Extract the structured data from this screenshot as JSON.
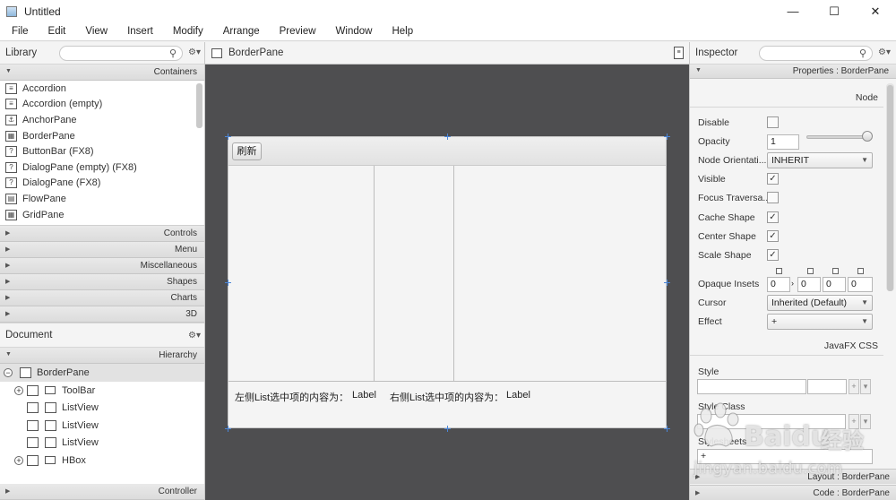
{
  "window": {
    "title": "Untitled",
    "minimize": "—",
    "maximize": "☐",
    "close": "✕"
  },
  "menu": [
    "File",
    "Edit",
    "View",
    "Insert",
    "Modify",
    "Arrange",
    "Preview",
    "Window",
    "Help"
  ],
  "library": {
    "title": "Library",
    "gear": "⚙▾",
    "containers_label": "Containers",
    "items": [
      {
        "label": "Accordion",
        "icon": "≡"
      },
      {
        "label": "Accordion  (empty)",
        "icon": "≡"
      },
      {
        "label": "AnchorPane",
        "icon": "⚓"
      },
      {
        "label": "BorderPane",
        "icon": "▦"
      },
      {
        "label": "ButtonBar  (FX8)",
        "icon": "?"
      },
      {
        "label": "DialogPane (empty)  (FX8)",
        "icon": "?"
      },
      {
        "label": "DialogPane  (FX8)",
        "icon": "?"
      },
      {
        "label": "FlowPane",
        "icon": "▤"
      },
      {
        "label": "GridPane",
        "icon": "▦"
      }
    ],
    "sections": [
      "Controls",
      "Menu",
      "Miscellaneous",
      "Shapes",
      "Charts",
      "3D"
    ]
  },
  "document": {
    "title": "Document",
    "gear": "⚙▾",
    "hierarchy_label": "Hierarchy",
    "rows": [
      "BorderPane",
      "ToolBar",
      "ListView",
      "ListView",
      "ListView",
      "HBox"
    ],
    "controller_label": "Controller"
  },
  "content": {
    "title": "BorderPane",
    "refresh_button": "刷新",
    "left_label": "左侧List选中项的内容为：",
    "left_value": "Label",
    "right_label": "右侧List选中项的内容为：",
    "right_value": "Label"
  },
  "inspector": {
    "title": "Inspector",
    "properties_bar": "Properties : BorderPane",
    "node_header": "Node",
    "css_header": "JavaFX CSS",
    "props": {
      "disable": "Disable",
      "opacity": "Opacity",
      "opacity_value": "1",
      "opacity_fraction": 1.0,
      "node_orientation": "Node Orientati...",
      "node_orientation_value": "INHERIT",
      "visible": "Visible",
      "focus_traversable": "Focus Traversa...",
      "cache_shape": "Cache Shape",
      "center_shape": "Center Shape",
      "scale_shape": "Scale Shape",
      "opaque_insets": "Opaque Insets",
      "insets": [
        "0",
        "0",
        "0",
        "0"
      ],
      "cursor": "Cursor",
      "cursor_value": "Inherited (Default)",
      "effect": "Effect",
      "effect_value": "+",
      "style": "Style",
      "style_class": "Style Class",
      "stylesheets": "Stylesheets"
    },
    "layout_bar": "Layout : BorderPane",
    "code_bar": "Code : BorderPane"
  },
  "watermark": {
    "text1": "Baidu",
    "text2": "经验",
    "text3": "jingyan.baidu.com"
  }
}
